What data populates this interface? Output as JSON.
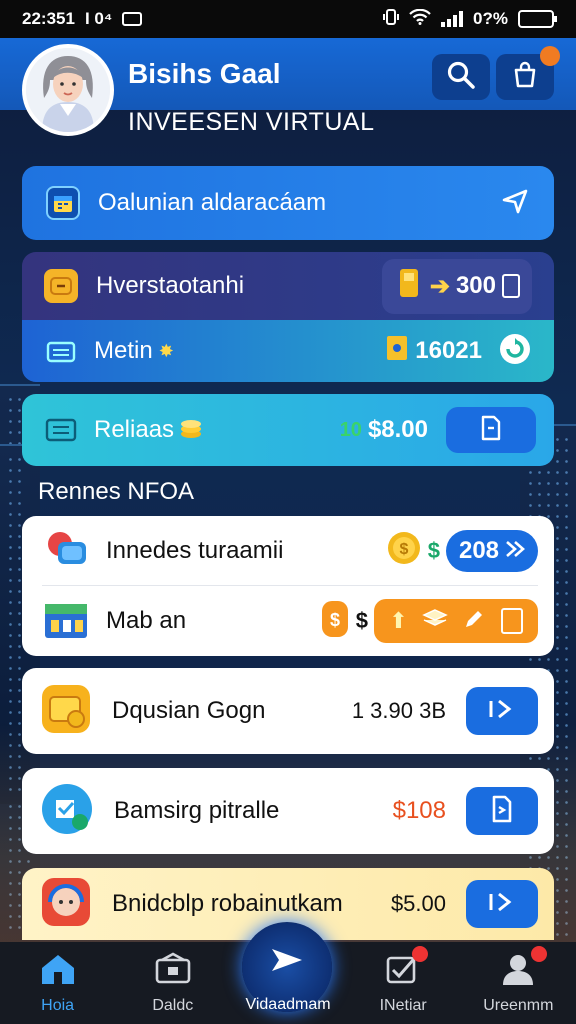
{
  "status_bar": {
    "time": "22:351",
    "left_extra": "I 0⁴",
    "battery_text": "0?%"
  },
  "header": {
    "name": "Bisihs Gaal",
    "subtitle": "INVEESEN VIRTUAL"
  },
  "banner": {
    "label": "Oalunian aldaracáam"
  },
  "rows": [
    {
      "label": "Hverstaotanhi",
      "value": "300"
    },
    {
      "label": "Metin",
      "value": "16021"
    },
    {
      "label": "Reliaas",
      "value": "$8.00",
      "prefix": "10"
    }
  ],
  "section": {
    "title": "Rennes NFOA"
  },
  "list_top": [
    {
      "label": "Innedes turaamii",
      "value": "208"
    },
    {
      "label": "Mab an"
    }
  ],
  "list_cards": [
    {
      "label": "Dqusian Gogn",
      "value": "1 3.90 3B"
    },
    {
      "label": "Bamsirg pitralle",
      "value": "$108"
    },
    {
      "label": "Bnidcblp robainutkam",
      "value": "$5.00"
    }
  ],
  "nav": [
    {
      "label": "Hoia"
    },
    {
      "label": "Daldc"
    },
    {
      "label": "Vidaadmam"
    },
    {
      "label": "INetiar"
    },
    {
      "label": "Ureenmm"
    }
  ],
  "colors": {
    "primary": "#1a6de0",
    "accent_orange": "#f7951d",
    "teal": "#2fc4d8",
    "dark_bg": "#0d1b3a"
  }
}
